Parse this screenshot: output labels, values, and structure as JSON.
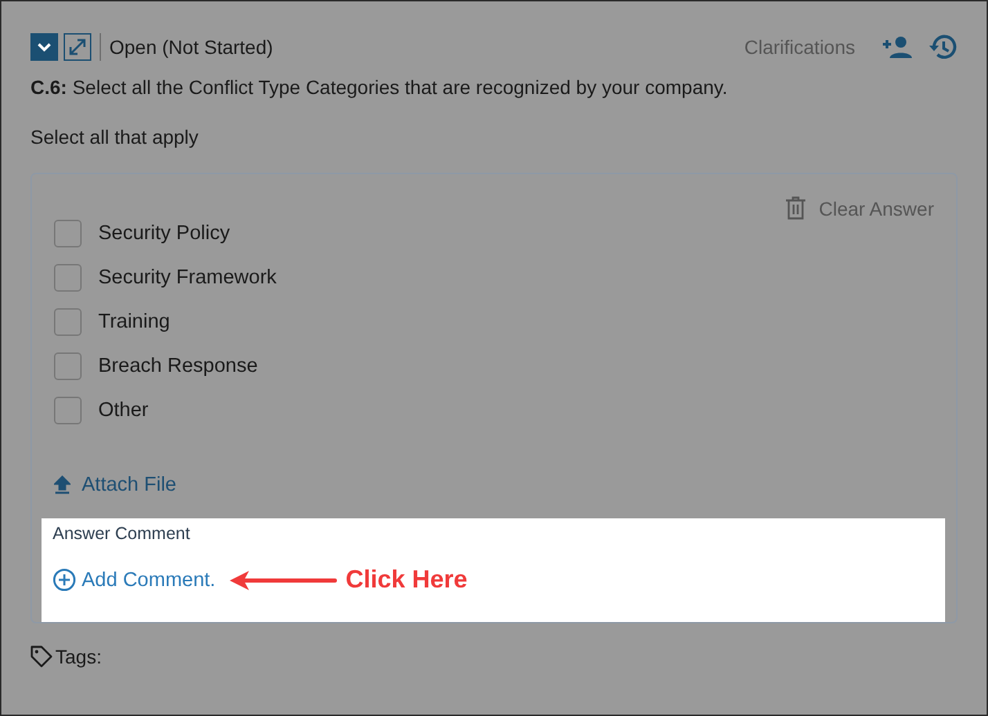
{
  "header": {
    "status": "Open (Not Started)",
    "clarifications": "Clarifications"
  },
  "question": "**C.6:** Select all the Conflict Type Categories that are recognized by your company.",
  "instruction": "Select all that apply",
  "clear_answer": "Clear Answer",
  "options": [
    {
      "label": "Security Policy",
      "checked": false
    },
    {
      "label": "Security Framework",
      "checked": false
    },
    {
      "label": "Training",
      "checked": false
    },
    {
      "label": "Breach Response",
      "checked": false
    },
    {
      "label": "Other",
      "checked": false
    }
  ],
  "attach_file": "Attach File",
  "comment": {
    "label": "Answer Comment",
    "add": "Add Comment."
  },
  "annotation": "Click Here",
  "tags": "Tags:"
}
